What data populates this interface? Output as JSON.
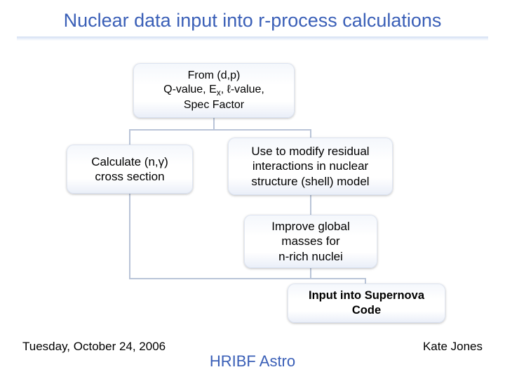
{
  "title": "Nuclear data input into r-process calculations",
  "boxes": {
    "top": "From (d,p)\nQ-value, Ex, ℓ-value,\nSpec Factor",
    "left": "Calculate (n,γ)\ncross section",
    "right": "Use to modify residual interactions in nuclear structure (shell) model",
    "mid": "Improve global masses for\nn-rich nuclei",
    "bottom": "Input into Supernova Code"
  },
  "footer": {
    "date": "Tuesday, October 24, 2006",
    "center": "HRIBF Astro",
    "author": "Kate Jones"
  },
  "chart_data": {
    "type": "diagram",
    "title": "Nuclear data input into r-process calculations",
    "nodes": [
      {
        "id": "A",
        "label": "From (d,p) Q-value, Ex, ℓ-value, Spec Factor"
      },
      {
        "id": "B",
        "label": "Calculate (n,γ) cross section"
      },
      {
        "id": "C",
        "label": "Use to modify residual interactions in nuclear structure (shell) model"
      },
      {
        "id": "D",
        "label": "Improve global masses for n-rich nuclei"
      },
      {
        "id": "E",
        "label": "Input into Supernova Code"
      }
    ],
    "edges": [
      {
        "from": "A",
        "to": "B"
      },
      {
        "from": "A",
        "to": "C"
      },
      {
        "from": "B",
        "to": "E"
      },
      {
        "from": "C",
        "to": "D"
      },
      {
        "from": "D",
        "to": "E"
      }
    ]
  }
}
